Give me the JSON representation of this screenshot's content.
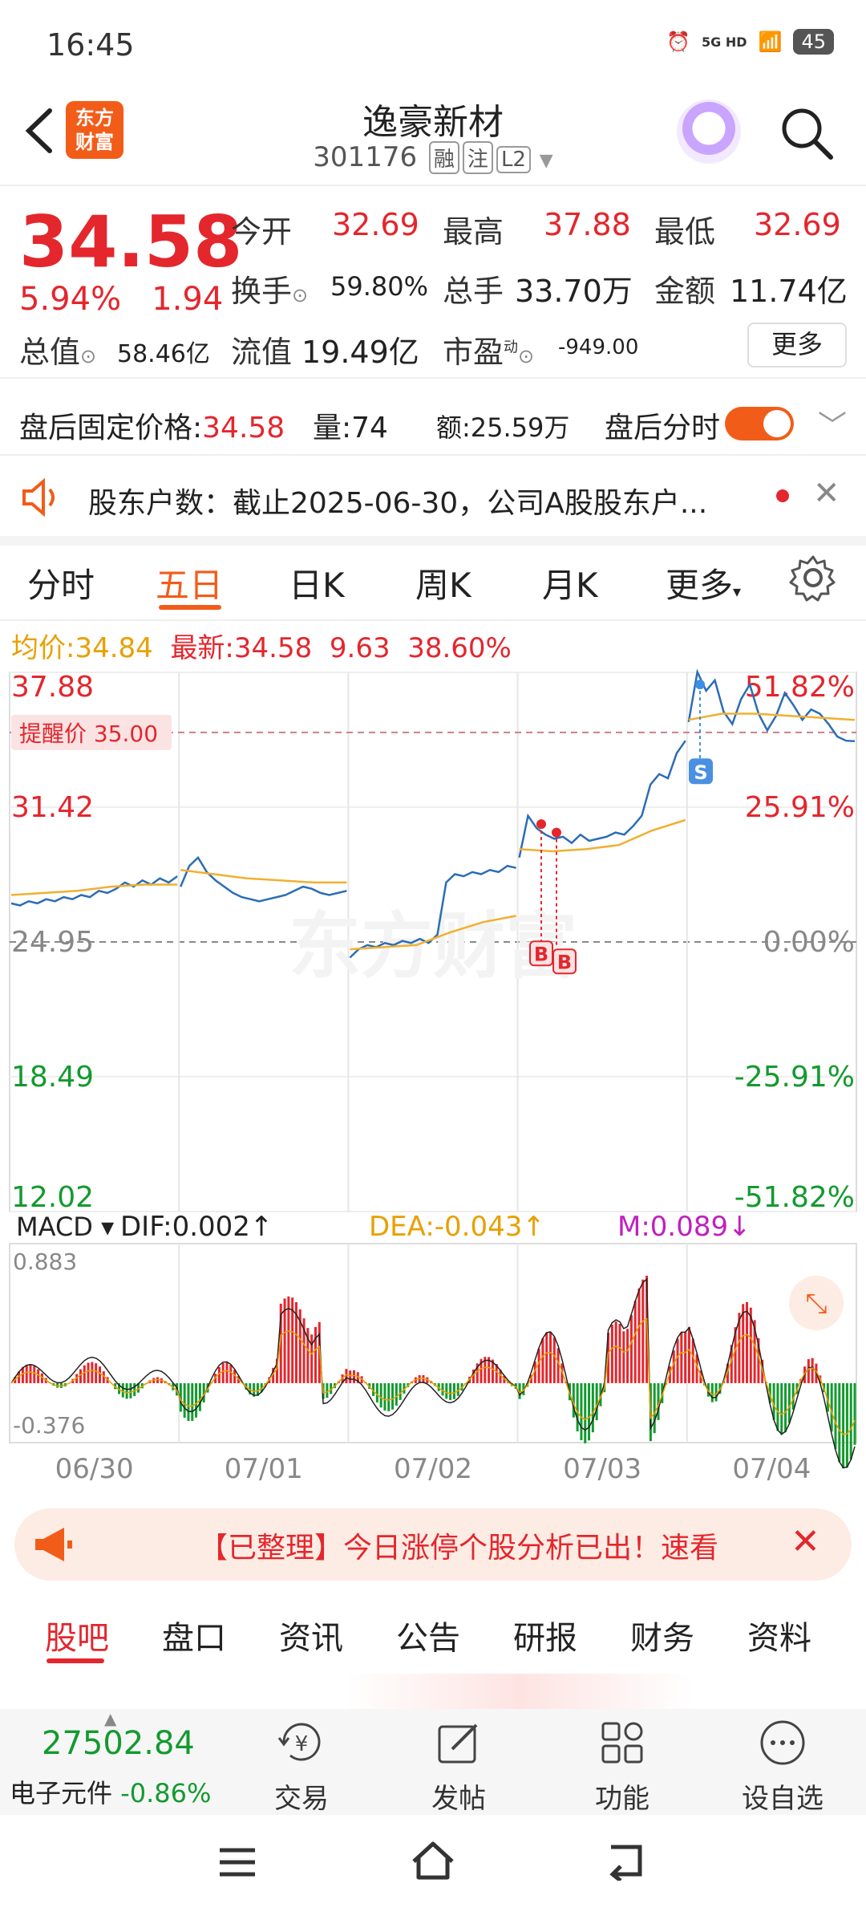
{
  "status": {
    "time": "16:45",
    "network": "5G HD",
    "battery": "45"
  },
  "header": {
    "logo_line1": "东方",
    "logo_line2": "财富",
    "title": "逸豪新材",
    "code": "301176",
    "tags": [
      "融",
      "注",
      "L2"
    ]
  },
  "quote": {
    "price": "34.58",
    "pct": "5.94%",
    "change": "1.94",
    "open_label": "今开",
    "open": "32.69",
    "high_label": "最高",
    "high": "37.88",
    "low_label": "最低",
    "low": "32.69",
    "turnover_label": "换手",
    "turnover": "59.80%",
    "volume_label": "总手",
    "volume": "33.70万",
    "amount_label": "金额",
    "amount": "11.74亿",
    "mcap_label": "总值",
    "mcap": "58.46亿",
    "float_label": "流值",
    "float": "19.49亿",
    "pe_label": "市盈",
    "pe_sup": "动",
    "pe": "-949.00",
    "more": "更多"
  },
  "afterhours": {
    "label": "盘后固定价格:",
    "price": "34.58",
    "vol_label": "量:",
    "vol": "74",
    "amt_label": "额:",
    "amt": "25.59万",
    "toggle_label": "盘后分时"
  },
  "notice": {
    "text": "股东户数：截止2025-06-30，公司A股股东户..."
  },
  "tabs": [
    "分时",
    "五日",
    "日K",
    "周K",
    "月K",
    "更多"
  ],
  "active_tab": 1,
  "avg": {
    "avg_label": "均价:",
    "avg": "34.84",
    "last_label": "最新:",
    "last": "34.58",
    "chg": "9.63",
    "pct": "38.60%"
  },
  "chart_data": {
    "type": "line",
    "price_axis": [
      "37.88",
      "31.42",
      "24.95",
      "18.49",
      "12.02"
    ],
    "pct_axis": [
      "51.82%",
      "25.91%",
      "0.00%",
      "-25.91%",
      "-51.82%"
    ],
    "alert": "提醒价 35.00",
    "dates": [
      "06/30",
      "07/01",
      "07/02",
      "07/03",
      "07/04"
    ],
    "macd": {
      "label": "MACD",
      "dif": "DIF:0.002↑",
      "dea": "DEA:-0.043↑",
      "m": "M:0.089↓",
      "top": "0.883",
      "bottom": "-0.376"
    },
    "markers": {
      "buy": "B",
      "sell": "S"
    },
    "watermark": "东方财富",
    "colors": {
      "price": "#2c6db5",
      "avg": "#f0b030",
      "up": "#e4262d",
      "down": "#139a2f"
    }
  },
  "banner": {
    "text": "【已整理】今日涨停个股分析已出！速看"
  },
  "bottom_tabs": [
    "股吧",
    "盘口",
    "资讯",
    "公告",
    "研报",
    "财务",
    "资料"
  ],
  "toolbar": {
    "index_value": "27502.84",
    "index_name": "电子元件",
    "index_pct": "-0.86%",
    "trade": "交易",
    "post": "发帖",
    "func": "功能",
    "watch": "设自选"
  }
}
